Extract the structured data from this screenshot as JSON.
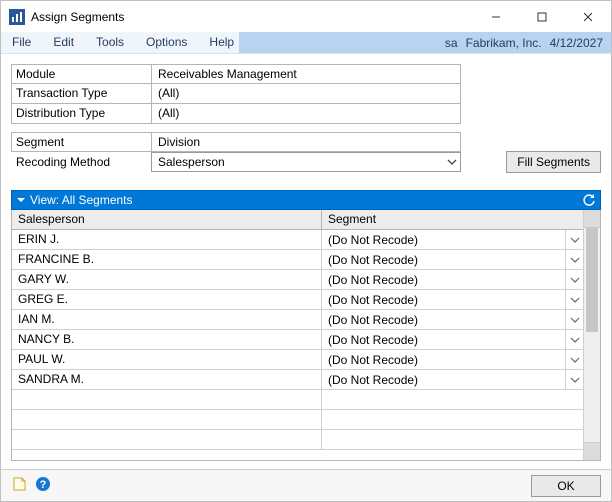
{
  "window": {
    "title": "Assign Segments"
  },
  "menu": {
    "file": "File",
    "edit": "Edit",
    "tools": "Tools",
    "options": "Options",
    "help": "Help"
  },
  "context": {
    "user": "sa",
    "company": "Fabrikam, Inc.",
    "date": "4/12/2027"
  },
  "form": {
    "module_label": "Module",
    "module_value": "Receivables Management",
    "txn_type_label": "Transaction Type",
    "txn_type_value": "(All)",
    "dist_type_label": "Distribution Type",
    "dist_type_value": "(All)",
    "segment_label": "Segment",
    "segment_value": "Division",
    "recoding_label": "Recoding Method",
    "recoding_value": "Salesperson"
  },
  "buttons": {
    "fill_segments": "Fill Segments",
    "ok": "OK"
  },
  "grid": {
    "view_label": "View: All Segments",
    "col_a": "Salesperson",
    "col_b": "Segment",
    "default_segment": "(Do Not Recode)",
    "rows": [
      {
        "salesperson": "ERIN J.",
        "segment": "(Do Not Recode)"
      },
      {
        "salesperson": "FRANCINE B.",
        "segment": "(Do Not Recode)"
      },
      {
        "salesperson": "GARY W.",
        "segment": "(Do Not Recode)"
      },
      {
        "salesperson": "GREG E.",
        "segment": "(Do Not Recode)"
      },
      {
        "salesperson": "IAN M.",
        "segment": "(Do Not Recode)"
      },
      {
        "salesperson": "NANCY B.",
        "segment": "(Do Not Recode)"
      },
      {
        "salesperson": "PAUL W.",
        "segment": "(Do Not Recode)"
      },
      {
        "salesperson": "SANDRA M.",
        "segment": "(Do Not Recode)"
      }
    ],
    "empty_rows": 3
  }
}
